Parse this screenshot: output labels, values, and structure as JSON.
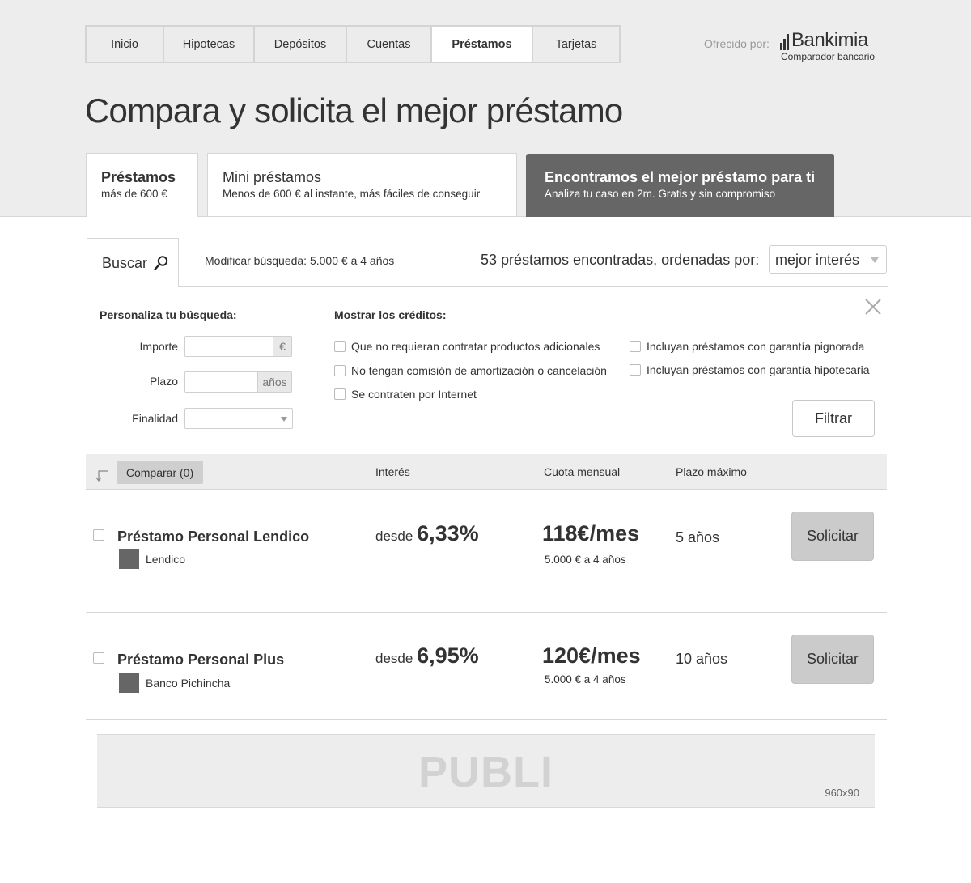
{
  "nav": {
    "items": [
      {
        "label": "Inicio",
        "active": false
      },
      {
        "label": "Hipotecas",
        "active": false
      },
      {
        "label": "Depósitos",
        "active": false
      },
      {
        "label": "Cuentas",
        "active": false
      },
      {
        "label": "Préstamos",
        "active": true
      },
      {
        "label": "Tarjetas",
        "active": false
      }
    ]
  },
  "brand": {
    "offered_by": "Ofrecido por:",
    "name": "Bankimia",
    "subtitle": "Comparador bancario"
  },
  "page_title": "Compara y solicita el mejor préstamo",
  "product_tabs": [
    {
      "title": "Préstamos",
      "subtitle": "más de 600 €",
      "state": "active"
    },
    {
      "title": "Mini préstamos",
      "subtitle": "Menos de 600 € al instante, más fáciles de conseguir",
      "state": "normal"
    },
    {
      "title": "Encontramos el mejor préstamo para ti",
      "subtitle": "Analiza tu caso en 2m. Gratis y sin compromiso",
      "state": "dark"
    }
  ],
  "search": {
    "tab_label": "Buscar",
    "modify_label": "Modificar búsqueda:",
    "modify_value": "5.000 € a 4 años",
    "results_text": "53 préstamos encontradas, ordenadas por:",
    "sort_value": "mejor interés"
  },
  "filters": {
    "title": "Personaliza tu búsqueda:",
    "importe_label": "Importe",
    "importe_value": "",
    "importe_unit": "€",
    "plazo_label": "Plazo",
    "plazo_value": "",
    "plazo_unit": "años",
    "finalidad_label": "Finalidad",
    "finalidad_value": "",
    "show_title": "Mostrar los créditos:",
    "checkboxes": [
      {
        "label": "Que no requieran contratar productos adicionales",
        "checked": false
      },
      {
        "label": "No tengan comisión de amortización o cancelación",
        "checked": false
      },
      {
        "label": "Se contraten por Internet",
        "checked": false
      },
      {
        "label": "Incluyan préstamos con garantía pignorada",
        "checked": false
      },
      {
        "label": "Incluyan préstamos con garantía hipotecaria",
        "checked": false
      }
    ],
    "filter_button": "Filtrar"
  },
  "table": {
    "compare_label": "Comparar (0)",
    "headers": {
      "interest": "Interés",
      "quota": "Cuota mensual",
      "term": "Plazo máximo"
    },
    "rows": [
      {
        "name": "Préstamo Personal Lendico",
        "bank": "Lendico",
        "rate_prefix": "desde",
        "rate": "6,33%",
        "quota": "118€/mes",
        "quota_detail": "5.000 € a 4 años",
        "term": "5 años",
        "apply": "Solicitar"
      },
      {
        "name": "Préstamo Personal Plus",
        "bank": "Banco Pichincha",
        "rate_prefix": "desde",
        "rate": "6,95%",
        "quota": "120€/mes",
        "quota_detail": "5.000 € a 4 años",
        "term": "10 años",
        "apply": "Solicitar"
      }
    ]
  },
  "ad": {
    "label": "PUBLI",
    "size": "960x90"
  },
  "colors": {
    "band": "#ededed",
    "dark_tab": "#666666",
    "button_grey": "#cbcbcb",
    "text": "#333333"
  }
}
